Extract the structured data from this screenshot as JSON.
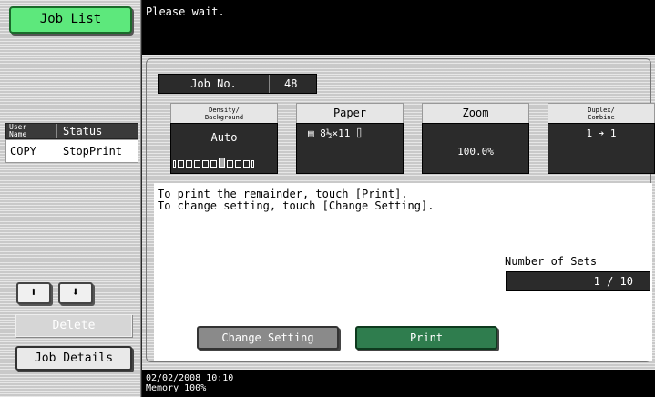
{
  "sidebar": {
    "job_list_label": "Job List",
    "table": {
      "user_name_header_line1": "User",
      "user_name_header_line2": "Name",
      "status_header": "Status",
      "rows": [
        {
          "user": "COPY",
          "status": "StopPrint"
        }
      ]
    },
    "up_icon": "up-arrow-icon",
    "down_icon": "down-arrow-icon",
    "up_glyph": "⬆",
    "down_glyph": "⬇",
    "delete_label": "Delete",
    "job_details_label": "Job Details"
  },
  "message": "Please wait.",
  "job": {
    "job_no_label": "Job No.",
    "job_no_value": "48"
  },
  "cards": {
    "density": {
      "header_line1": "Density/",
      "header_line2": "Background",
      "value": "Auto",
      "level": 6,
      "levels": 9
    },
    "paper": {
      "header": "Paper",
      "value": "▤ 8½×11 ⌷"
    },
    "zoom": {
      "header": "Zoom",
      "value": "100.0%"
    },
    "duplex": {
      "header_line1": "Duplex/",
      "header_line2": "Combine",
      "value": "1 ➔ 1"
    }
  },
  "instructions": {
    "line1": "To print the remainder, touch [Print].",
    "line2": "To change setting, touch [Change Setting]."
  },
  "sets": {
    "label": "Number of Sets",
    "value": "1 / 10"
  },
  "buttons": {
    "change_setting": "Change Setting",
    "print": "Print"
  },
  "footer": {
    "datetime": "02/02/2008   10:10",
    "memory": "Memory        100%"
  },
  "colors": {
    "job_list_green": "#5de87c",
    "print_green": "#2f7d4e",
    "dark_panel": "#2b2b2b"
  }
}
